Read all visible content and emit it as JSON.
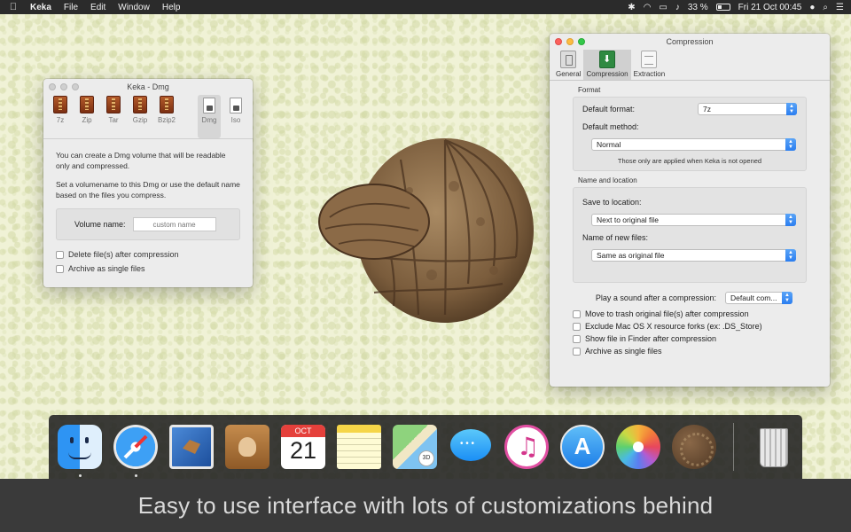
{
  "menubar": {
    "app_name": "Keka",
    "menus": [
      "File",
      "Edit",
      "Window",
      "Help"
    ],
    "battery": "33 %",
    "datetime": "Fri 21 Oct  00:45",
    "status_icons": [
      "bluetooth-icon",
      "wifi-icon",
      "airplay-icon",
      "volume-icon",
      "battery-icon",
      "user-icon",
      "spotlight-icon",
      "notification-center-icon"
    ]
  },
  "dmg_window": {
    "title": "Keka - Dmg",
    "formats": [
      "7z",
      "Zip",
      "Tar",
      "Gzip",
      "Bzip2"
    ],
    "doc_formats": [
      "Dmg",
      "Iso"
    ],
    "selected_format": "Dmg",
    "description_1": "You can create a Dmg volume that will be readable only and compressed.",
    "description_2": "Set a volumename to this Dmg or use the default name based on the files you compress.",
    "volume_label": "Volume name:",
    "volume_placeholder": "custom name",
    "options": [
      "Delete file(s) after compression",
      "Archive as single files"
    ]
  },
  "compression_window": {
    "title": "Compression",
    "tabs": [
      "General",
      "Compression",
      "Extraction"
    ],
    "selected_tab": "Compression",
    "format_section": "Format",
    "default_format_label": "Default format:",
    "default_format_value": "7z",
    "default_method_label": "Default method:",
    "default_method_value": "Normal",
    "note": "Those only are applied when Keka is not opened",
    "location_section": "Name and location",
    "save_label": "Save to location:",
    "save_value": "Next to original file",
    "name_label": "Name of new files:",
    "name_value": "Same as original file",
    "sound_label": "Play a sound after a compression:",
    "sound_value": "Default com...",
    "options": [
      "Move to trash original file(s) after compression",
      "Exclude Mac OS X resource forks (ex: .DS_Store)",
      "Show file in Finder after compression",
      "Archive as single files"
    ]
  },
  "dock": {
    "calendar_month": "OCT",
    "calendar_day": "21",
    "apps": [
      "Finder",
      "Safari",
      "Mail",
      "Contacts",
      "Calendar",
      "Notes",
      "Maps",
      "Messages",
      "iTunes",
      "App Store",
      "Photos",
      "Keka",
      "Trash"
    ]
  },
  "caption": "Easy to use interface with lots of customizations behind",
  "colors": {
    "desktop": "#f0f2d6",
    "popup_accent": "#2b7ef0",
    "caption_bg": "#3a3a3a",
    "caption_text": "#d9d9d9"
  }
}
